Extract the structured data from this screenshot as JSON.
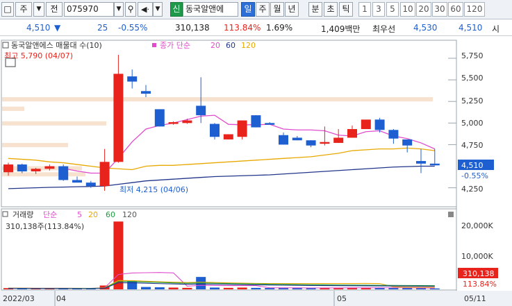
{
  "toolbar": {
    "market": "주",
    "jeon": "전",
    "code": "075970",
    "stock_name": "동국알앤에",
    "sin": "신",
    "periods": [
      "일",
      "주",
      "월",
      "년",
      "분",
      "초",
      "틱"
    ],
    "numbers": [
      "1",
      "3",
      "5",
      "10",
      "20",
      "30",
      "60",
      "120"
    ]
  },
  "info": {
    "price": "4,510",
    "change": "25",
    "change_pct": "-0.55%",
    "volume": "310,138",
    "vol_ratio": "113.84%",
    "turnover": "1.69%",
    "amount": "1,409백만",
    "best_ask_label": "최우선",
    "best_ask": "4,530",
    "best_bid": "4,510",
    "si": "시"
  },
  "price_panel": {
    "title": "동국알앤에스 매물대 수(10)",
    "ma_label": "종가 단순",
    "ma_periods": [
      "20",
      "60",
      "120"
    ],
    "high_label": "최고 5,790 (04/07)",
    "low_label": "최저 4,215 (04/06)",
    "y_ticks": [
      "5,750",
      "5,500",
      "5,250",
      "5,000",
      "4,750",
      "4,250"
    ],
    "price_tag": "4,510",
    "price_tag_pct": "-0.55%"
  },
  "volume_panel": {
    "title": "거래량",
    "ma_label": "단순",
    "ma_periods": [
      "5",
      "20",
      "60",
      "120"
    ],
    "current_label": "310,138주(113.84%)",
    "y_ticks": [
      "20,000K",
      "10,000K"
    ],
    "vol_tag": "310,138",
    "vol_tag_pct": "113.84%"
  },
  "x_axis": {
    "labels": [
      "2022/03",
      "04",
      "05",
      "05/11"
    ]
  },
  "colors": {
    "up": "#e8231c",
    "down": "#1d5fd0",
    "ma5": "#e04ccd",
    "ma20": "#e8a800",
    "ma60": "#1a9a3a",
    "ma120": "#22358a",
    "profile": "#f7e2cf"
  },
  "chart_data": {
    "type": "candlestick",
    "ohlc": [
      [
        4430,
        4540,
        4390,
        4520
      ],
      [
        4520,
        4530,
        4420,
        4440
      ],
      [
        4440,
        4480,
        4410,
        4470
      ],
      [
        4470,
        4520,
        4450,
        4500
      ],
      [
        4500,
        4520,
        4330,
        4340
      ],
      [
        4340,
        4380,
        4320,
        4310
      ],
      [
        4310,
        4330,
        4250,
        4270
      ],
      [
        4270,
        4700,
        4215,
        4550
      ],
      [
        4550,
        5790,
        4540,
        5570
      ],
      [
        5540,
        5620,
        5400,
        5480
      ],
      [
        5370,
        5440,
        5300,
        5340
      ],
      [
        5160,
        5160,
        4960,
        4960
      ],
      [
        4990,
        5020,
        4980,
        5010
      ],
      [
        5000,
        5050,
        4990,
        5030
      ],
      [
        5200,
        5530,
        5000,
        5090
      ],
      [
        4990,
        5000,
        4810,
        4840
      ],
      [
        4810,
        4860,
        4810,
        4870
      ],
      [
        4840,
        5030,
        4810,
        5030
      ],
      [
        5090,
        5090,
        4950,
        4950
      ],
      [
        5000,
        5010,
        4990,
        4980
      ],
      [
        4860,
        4890,
        4750,
        4750
      ],
      [
        4830,
        4850,
        4800,
        4800
      ],
      [
        4800,
        4800,
        4720,
        4740
      ],
      [
        4760,
        4960,
        4740,
        4780
      ],
      [
        4770,
        4930,
        4770,
        4830
      ],
      [
        4830,
        4970,
        4830,
        4930
      ],
      [
        4930,
        5030,
        4930,
        5040
      ],
      [
        5040,
        5060,
        4890,
        4920
      ],
      [
        4920,
        4930,
        4760,
        4820
      ],
      [
        4810,
        4810,
        4660,
        4740
      ],
      [
        4560,
        4700,
        4420,
        4530
      ],
      [
        4530,
        4700,
        4510,
        4510
      ]
    ],
    "volumes_k": [
      410,
      380,
      350,
      300,
      360,
      340,
      330,
      1300,
      23000,
      2800,
      800,
      700,
      600,
      500,
      4200,
      600,
      500,
      600,
      500,
      450,
      480,
      500,
      420,
      520,
      480,
      600,
      550,
      500,
      520,
      480,
      380,
      310
    ],
    "ma5": [
      null,
      null,
      null,
      null,
      4476,
      4444,
      4420,
      4420,
      4592,
      4782,
      4930,
      4972,
      5000,
      5040,
      5080,
      5090,
      4985,
      4980,
      4980,
      4985,
      4930,
      4920,
      4920,
      4910,
      4860,
      4850,
      4900,
      4910,
      4850,
      4820,
      4770,
      4700
    ],
    "ma20": [
      4590,
      4580,
      4570,
      4550,
      4540,
      4520,
      4500,
      4480,
      4470,
      4460,
      4500,
      4510,
      4510,
      4520,
      4530,
      4540,
      4550,
      4560,
      4570,
      4580,
      4590,
      4600,
      4610,
      4630,
      4650,
      4680,
      4690,
      4700,
      4700,
      4710,
      4700,
      4680
    ],
    "ma60": [
      4240,
      4245,
      4250,
      4255,
      4258,
      4262,
      4265,
      4270,
      4290,
      4310,
      4330,
      4340,
      4350,
      4360,
      4370,
      4380,
      4385,
      4390,
      4395,
      4400,
      4410,
      4420,
      4430,
      4440,
      4450,
      4460,
      4470,
      4480,
      4490,
      4495,
      4500,
      4500
    ],
    "y_range": [
      4200,
      5850
    ],
    "volume_range_k": [
      0,
      24000
    ]
  }
}
